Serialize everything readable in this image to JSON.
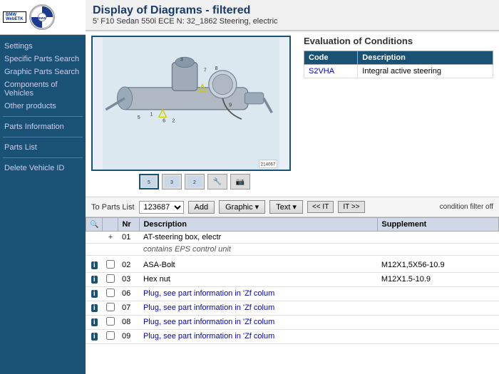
{
  "header": {
    "title": "Display of Diagrams - filtered",
    "subtitle": "5' F10 Sedan 550i ECE N: 32_1862 Steering, electric"
  },
  "sidebar": {
    "logo_text": "BMWWebETK",
    "items": [
      {
        "label": "Settings",
        "id": "settings"
      },
      {
        "label": "Specific Parts Search",
        "id": "specific-parts-search"
      },
      {
        "label": "Graphic Parts Search",
        "id": "graphic-parts-search"
      },
      {
        "label": "Components of Vehicles",
        "id": "components-of-vehicles"
      },
      {
        "label": "Other products",
        "id": "other-products"
      },
      {
        "label": "Parts Information",
        "id": "parts-information"
      },
      {
        "label": "Parts List",
        "id": "parts-list"
      },
      {
        "label": "Delete Vehicle ID",
        "id": "delete-vehicle-id"
      }
    ]
  },
  "evaluation": {
    "title": "Evaluation of Conditions",
    "table": {
      "headers": [
        "Code",
        "Description"
      ],
      "rows": [
        {
          "code": "S2VHA",
          "description": "Integral active steering"
        }
      ]
    }
  },
  "toolbar": {
    "parts_list_label": "To Parts List",
    "parts_list_value": "123687",
    "add_label": "Add",
    "graphic_label": "Graphic ▾",
    "text_label": "Text ▾",
    "nav_left": "<< IT",
    "nav_right": "IT >>",
    "condition_filter": "condition filter off"
  },
  "parts_table": {
    "headers": [
      "",
      "",
      "Nr",
      "Description",
      "Supplement"
    ],
    "rows": [
      {
        "info": false,
        "check": false,
        "nr": "01",
        "desc": "AT-steering box, electr",
        "supp": "",
        "has_sub": true,
        "sub_desc": "contains EPS control unit",
        "spacer_after": true
      },
      {
        "info": true,
        "check": true,
        "nr": "02",
        "desc": "ASA-Bolt",
        "supp": "M12X1,5X56-10.9",
        "has_sub": false
      },
      {
        "info": true,
        "check": true,
        "nr": "03",
        "desc": "Hex nut",
        "supp": "M12X1.5-10.9",
        "has_sub": false
      },
      {
        "info": true,
        "check": true,
        "nr": "06",
        "desc": "Plug, see part information in 'Zf colum",
        "supp": "",
        "has_sub": false,
        "is_link": true
      },
      {
        "info": true,
        "check": true,
        "nr": "07",
        "desc": "Plug, see part information in 'Zf colum",
        "supp": "",
        "has_sub": false,
        "is_link": true
      },
      {
        "info": true,
        "check": true,
        "nr": "08",
        "desc": "Plug, see part information in 'Zf colum",
        "supp": "",
        "has_sub": false,
        "is_link": true
      },
      {
        "info": true,
        "check": true,
        "nr": "09",
        "desc": "Plug, see part information in 'Zf colum",
        "supp": "",
        "has_sub": false,
        "is_link": true
      }
    ]
  }
}
